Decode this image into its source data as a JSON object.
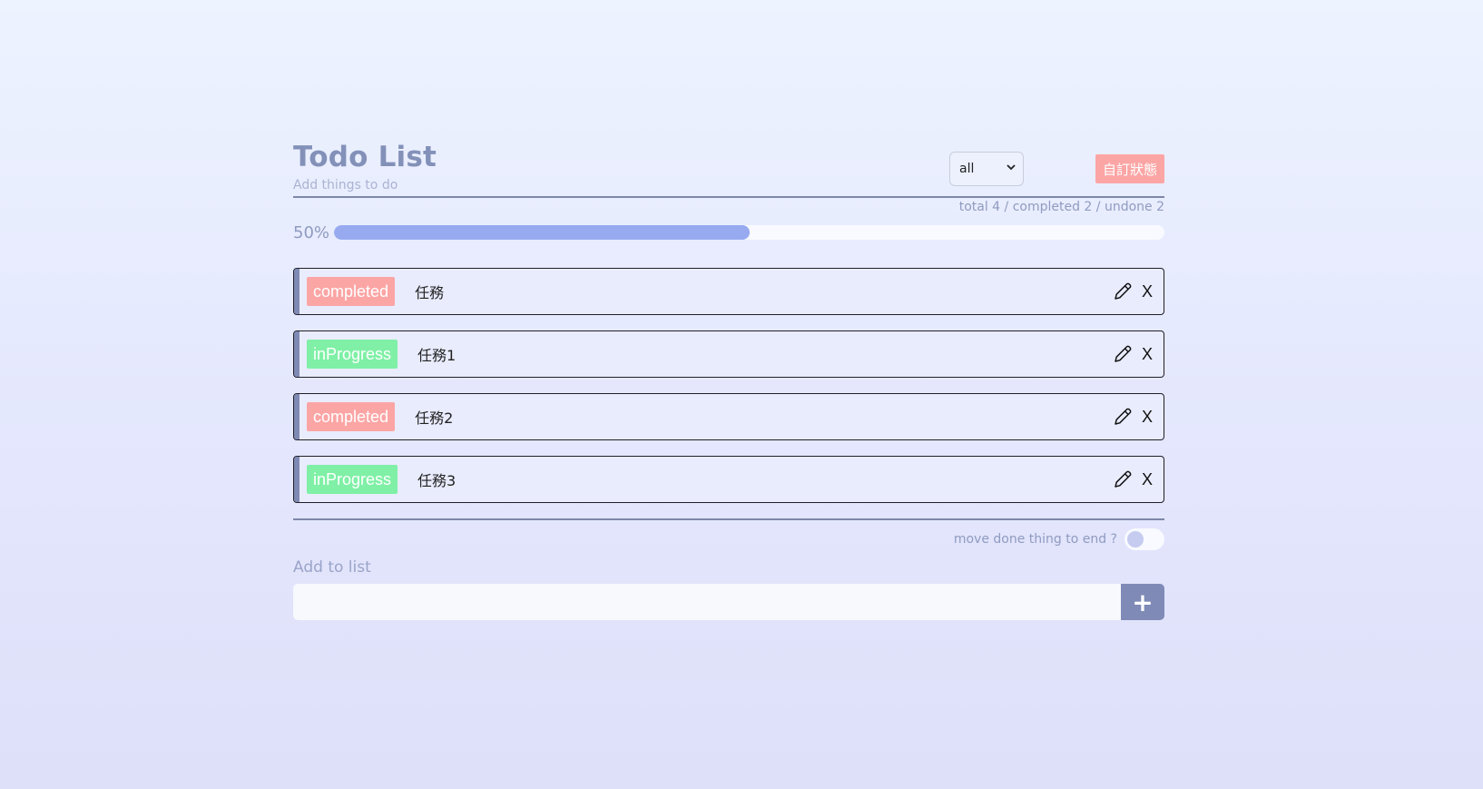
{
  "header": {
    "title": "Todo List",
    "subtitle": "Add things to do",
    "filter_selected": "all",
    "custom_status_label": "自訂狀態"
  },
  "summary": {
    "text": "total 4 / completed 2 / undone 2"
  },
  "progress": {
    "label": "50%",
    "value": 0.5
  },
  "todos": [
    {
      "status": "completed",
      "text": "任務",
      "status_color": "#fca5a5"
    },
    {
      "status": "inProgress",
      "text": "任務1",
      "status_color": "#7ff0a6"
    },
    {
      "status": "completed",
      "text": "任務2",
      "status_color": "#fca5a5"
    },
    {
      "status": "inProgress",
      "text": "任務3",
      "status_color": "#7ff0a6"
    }
  ],
  "actions": {
    "edit_icon": "pencil-icon",
    "delete_label": "X"
  },
  "settings": {
    "move_done_label": "move done thing to end ?",
    "move_done_enabled": false
  },
  "add": {
    "label": "Add to list",
    "placeholder": "",
    "button_label": "+"
  },
  "colors": {
    "accent": "#7f8ab7",
    "progress_fill": "#97aaf0",
    "completed": "#fca5a5",
    "in_progress": "#7ff0a6"
  }
}
